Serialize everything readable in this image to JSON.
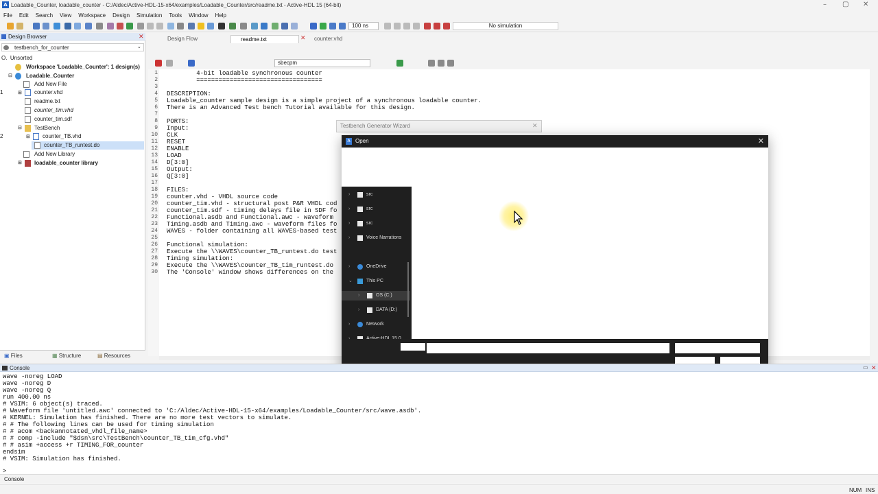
{
  "window": {
    "title": "Loadable_Counter, loadable_counter - C:/Aldec/Active-HDL-15-x64/examples/Loadable_Counter/src/readme.txt - Active-HDL 15 (64-bit)",
    "logo": "A"
  },
  "menu": [
    "File",
    "Edit",
    "Search",
    "View",
    "Workspace",
    "Design",
    "Simulation",
    "Tools",
    "Window",
    "Help"
  ],
  "toolbar": {
    "sim_time": "100 ns",
    "sim_status": "No simulation"
  },
  "design_browser": {
    "title": "Design Browser",
    "selector": "testbench_for_counter",
    "tree": [
      {
        "label": "Unsorted",
        "prefix": "O."
      },
      {
        "label": "Workspace 'Loadable_Counter': 1 design(s)",
        "bold": true
      },
      {
        "label": "Loadable_Counter",
        "bold": true
      },
      {
        "label": "Add New File"
      },
      {
        "label": "counter.vhd",
        "num": "1"
      },
      {
        "label": "readme.txt"
      },
      {
        "label": "counter_tim.vhd",
        "italic": true
      },
      {
        "label": "counter_tim.sdf"
      },
      {
        "label": "TestBench"
      },
      {
        "label": "counter_TB.vhd",
        "num": "2"
      },
      {
        "label": "counter_TB_runtest.do"
      },
      {
        "label": "Add New Library"
      },
      {
        "label": "loadable_counter library",
        "bold": true
      }
    ],
    "tabs": [
      "Files",
      "Structure",
      "Resources"
    ]
  },
  "editor": {
    "tabs": [
      "Design Flow",
      "readme.txt",
      "counter.vhd"
    ],
    "search_value": "sbecpm",
    "lines": [
      "        4-bit loadable synchronous counter",
      "        ==================================",
      "",
      "DESCRIPTION:",
      "Loadable_counter sample design is a simple project of a synchronous loadable counter.",
      "There is an Advanced Test bench Tutorial available for this design.",
      "",
      "PORTS:",
      "Input:",
      "CLK",
      "RESET",
      "ENABLE",
      "LOAD",
      "D[3:0]",
      "Output:",
      "Q[3:0]",
      "",
      "FILES:",
      "counter.vhd - VHDL source code",
      "counter_tim.vhd - structural post P&R VHDL cod",
      "counter_tim.sdf - timing delays file in SDF fo",
      "Functional.asdb and Functional.awc - waveform",
      "Timing.asdb and Timing.awc - waveform files fo",
      "WAVES - folder containing all WAVES-based test",
      "",
      "Functional simulation:",
      "Execute the \\\\WAVES\\counter_TB_runtest.do test",
      "Timing simulation:",
      "Execute the \\\\WAVES\\counter_TB_tim_runtest.do",
      "The 'Console' window shows differences on the"
    ]
  },
  "wizard": {
    "title": "Testbench Generator Wizard"
  },
  "open_dialog": {
    "title": "Open",
    "nav": [
      {
        "label": "src",
        "type": "file"
      },
      {
        "label": "src",
        "type": "file"
      },
      {
        "label": "src",
        "type": "file"
      },
      {
        "label": "Voice Narrations",
        "type": "file"
      },
      {
        "label": "OneDrive",
        "type": "cloud"
      },
      {
        "label": "This PC",
        "type": "pc",
        "expanded": true
      },
      {
        "label": "OS (C:)",
        "type": "drive",
        "selected": true
      },
      {
        "label": "DATA (D:)",
        "type": "drive"
      },
      {
        "label": "Network",
        "type": "network"
      },
      {
        "label": "Active-HDL 15.0",
        "type": "file"
      }
    ]
  },
  "console": {
    "title": "Console",
    "lines": [
      "wave -noreg LOAD",
      "wave -noreg D",
      "wave -noreg Q",
      "run 400.00 ns",
      "# VSIM: 6 object(s) traced.",
      "# Waveform file 'untitled.awc' connected to 'C:/Aldec/Active-HDL-15-x64/examples/Loadable_Counter/src/wave.asdb'.",
      "# KERNEL: Simulation has finished. There are no more test vectors to simulate.",
      "# # The following lines can be used for timing simulation",
      "# # acom <backannotated_vhdl_file_name>",
      "# # comp -include \"$dsn\\src\\TestBench\\counter_TB_tim_cfg.vhd\"",
      "# # asim +access +r TIMING_FOR_counter",
      "endsim",
      "# VSIM: Simulation has finished."
    ],
    "prompt": ">",
    "tab": "Console"
  },
  "status": {
    "num": "NUM",
    "ins": "INS"
  }
}
